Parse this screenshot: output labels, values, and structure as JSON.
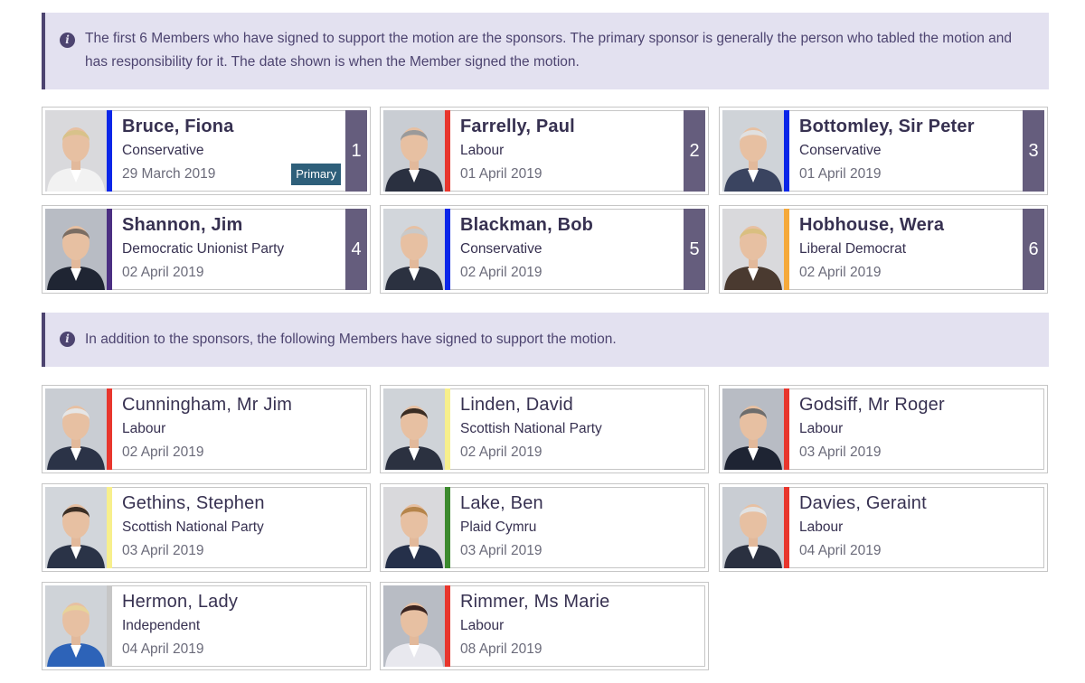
{
  "colors": {
    "conservative": "#0a26e8",
    "labour": "#e8362d",
    "liberal_democrat": "#f5a93a",
    "snp": "#f7ef8c",
    "dup": "#4b2f82",
    "plaid": "#3c8a2e",
    "independent": "#c6c6c6"
  },
  "sponsors_info": {
    "icon": "info-icon",
    "text": "The first 6 Members who have signed to support the motion are the sponsors. The primary sponsor is generally the person who tabled the motion and has responsibility for it. The date shown is when the Member signed the motion."
  },
  "sponsors": [
    {
      "name": "Bruce, Fiona",
      "party": "Conservative",
      "date": "29 March 2019",
      "number": "1",
      "badge": "Primary",
      "party_color": "#0a26e8"
    },
    {
      "name": "Farrelly, Paul",
      "party": "Labour",
      "date": "01 April 2019",
      "number": "2",
      "party_color": "#e8362d"
    },
    {
      "name": "Bottomley, Sir Peter",
      "party": "Conservative",
      "date": "01 April 2019",
      "number": "3",
      "party_color": "#0a26e8"
    },
    {
      "name": "Shannon, Jim",
      "party": "Democratic Unionist Party",
      "date": "02 April 2019",
      "number": "4",
      "party_color": "#4b2f82"
    },
    {
      "name": "Blackman, Bob",
      "party": "Conservative",
      "date": "02 April 2019",
      "number": "5",
      "party_color": "#0a26e8"
    },
    {
      "name": "Hobhouse, Wera",
      "party": "Liberal Democrat",
      "date": "02 April 2019",
      "number": "6",
      "party_color": "#f5a93a"
    }
  ],
  "supporters_info": {
    "icon": "info-icon",
    "text": "In addition to the sponsors, the following Members have signed to support the motion."
  },
  "supporters": [
    {
      "name": "Cunningham, Mr Jim",
      "party": "Labour",
      "date": "02 April 2019",
      "party_color": "#e8362d"
    },
    {
      "name": "Linden, David",
      "party": "Scottish National Party",
      "date": "02 April 2019",
      "party_color": "#f7ef8c"
    },
    {
      "name": "Godsiff, Mr Roger",
      "party": "Labour",
      "date": "03 April 2019",
      "party_color": "#e8362d"
    },
    {
      "name": "Gethins, Stephen",
      "party": "Scottish National Party",
      "date": "03 April 2019",
      "party_color": "#f7ef8c"
    },
    {
      "name": "Lake, Ben",
      "party": "Plaid Cymru",
      "date": "03 April 2019",
      "party_color": "#3c8a2e"
    },
    {
      "name": "Davies, Geraint",
      "party": "Labour",
      "date": "04 April 2019",
      "party_color": "#e8362d"
    },
    {
      "name": "Hermon, Lady",
      "party": "Independent",
      "date": "04 April 2019",
      "party_color": "#c6c6c6"
    },
    {
      "name": "Rimmer, Ms Marie",
      "party": "Labour",
      "date": "08 April 2019",
      "party_color": "#e8362d"
    }
  ]
}
